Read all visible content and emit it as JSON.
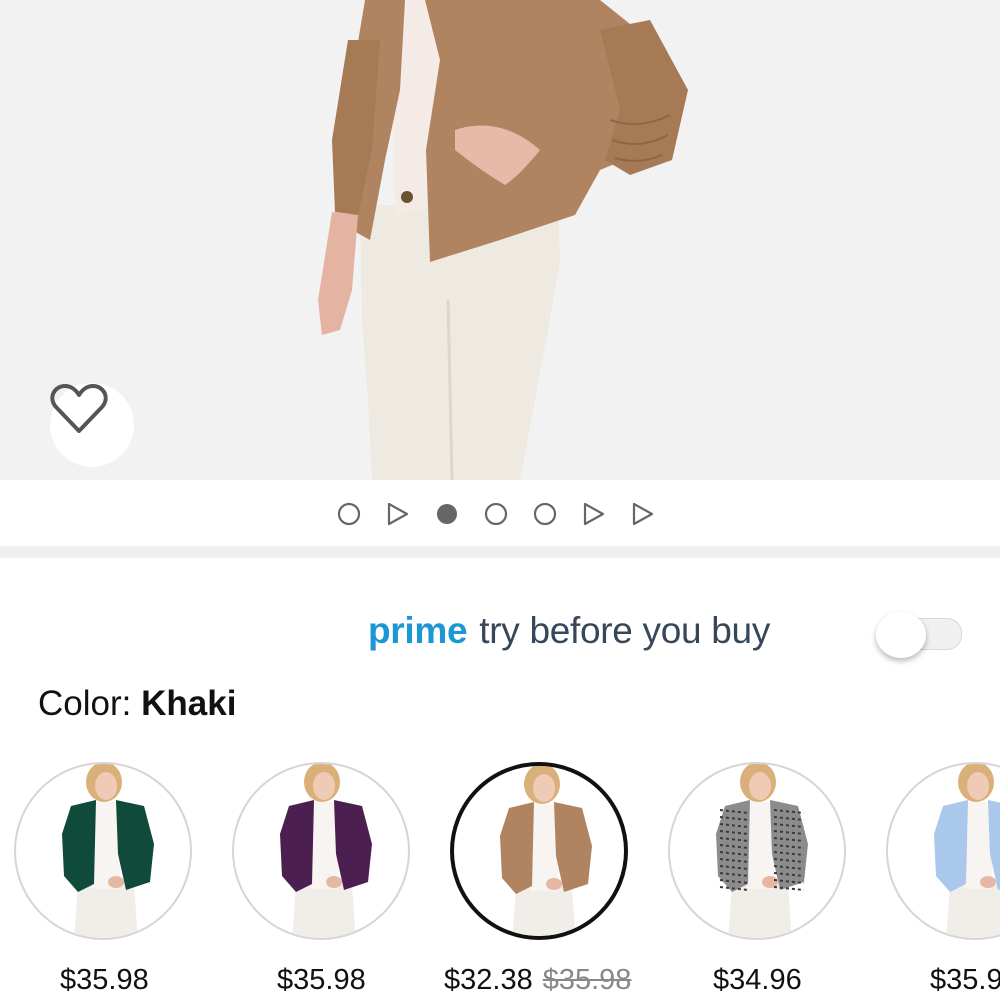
{
  "colors": {
    "prime_blue": "#1b97d3",
    "text_dark": "#37475a",
    "selected_border": "#111111"
  },
  "hero": {
    "wishlist_icon": "heart-outline-icon",
    "carousel": {
      "items": [
        {
          "kind": "image",
          "icon": "circle-outline-icon",
          "active": false
        },
        {
          "kind": "video",
          "icon": "play-outline-icon",
          "active": false
        },
        {
          "kind": "image",
          "icon": "circle-filled-icon",
          "active": true
        },
        {
          "kind": "image",
          "icon": "circle-outline-icon",
          "active": false
        },
        {
          "kind": "image",
          "icon": "circle-outline-icon",
          "active": false
        },
        {
          "kind": "video",
          "icon": "play-outline-icon",
          "active": false
        },
        {
          "kind": "video",
          "icon": "play-outline-icon",
          "active": false
        }
      ]
    }
  },
  "prime": {
    "brand": "prime",
    "text": "try before you buy",
    "toggle_on": false
  },
  "color": {
    "label": "Color:",
    "value": "Khaki"
  },
  "swatches": [
    {
      "color_name": "dark green",
      "jacket_color": "#0f4a3a",
      "price": "$35.98",
      "old_price": "",
      "selected": false
    },
    {
      "color_name": "purple",
      "jacket_color": "#4b1f4f",
      "price": "$35.98",
      "old_price": "",
      "selected": false
    },
    {
      "color_name": "khaki",
      "jacket_color": "#b08460",
      "price": "$32.38",
      "old_price": "$35.98",
      "selected": true
    },
    {
      "color_name": "houndstooth",
      "jacket_color": "#8c8c8c",
      "price": "$34.96",
      "old_price": "",
      "selected": false
    },
    {
      "color_name": "light blue",
      "jacket_color": "#a9c8ec",
      "price": "$35.9",
      "old_price": "",
      "selected": false
    }
  ]
}
